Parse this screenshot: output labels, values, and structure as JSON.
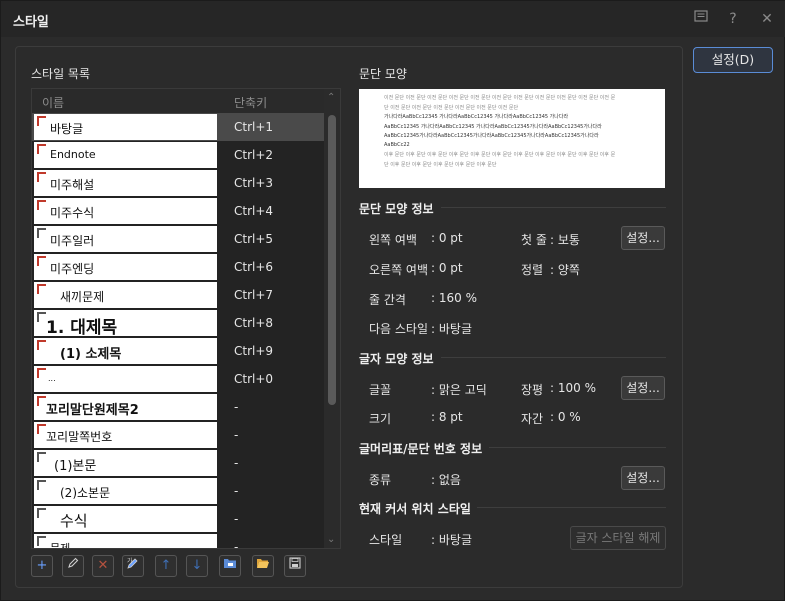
{
  "window": {
    "title": "스타일"
  },
  "titlebar_icons": [
    "memo-icon",
    "help-icon",
    "close-icon"
  ],
  "settings_button": "설정(D)",
  "style_list": {
    "label": "스타일 목록",
    "col_name": "이름",
    "col_key": "단축키",
    "items": [
      {
        "name": "바탕글",
        "key": "Ctrl+1",
        "kind": "char",
        "selected": true
      },
      {
        "name": "Endnote",
        "key": "Ctrl+2",
        "kind": "char"
      },
      {
        "name": "미주해설",
        "key": "Ctrl+3",
        "kind": "char"
      },
      {
        "name": "미주수식",
        "key": "Ctrl+4",
        "kind": "char"
      },
      {
        "name": "미주일러",
        "key": "Ctrl+5",
        "kind": "para"
      },
      {
        "name": "미주엔딩",
        "key": "Ctrl+6",
        "kind": "char"
      },
      {
        "name": "새끼문제",
        "key": "Ctrl+7",
        "kind": "char"
      },
      {
        "name": "1. 대제목",
        "key": "Ctrl+8",
        "kind": "para"
      },
      {
        "name": "(1) 소제목",
        "key": "Ctrl+9",
        "kind": "char"
      },
      {
        "name": "...",
        "key": "Ctrl+0",
        "kind": "char"
      },
      {
        "name": "꼬리말단원제목2",
        "key": "-",
        "kind": "char"
      },
      {
        "name": "꼬리말쪽번호",
        "key": "-",
        "kind": "char"
      },
      {
        "name": "(1)본문",
        "key": "-",
        "kind": "para"
      },
      {
        "name": "(2)소본문",
        "key": "-",
        "kind": "para"
      },
      {
        "name": "수식",
        "key": "-",
        "kind": "para"
      },
      {
        "name": "문제",
        "key": "-",
        "kind": "para"
      }
    ]
  },
  "toolbar_icons": [
    "add-icon",
    "edit-icon",
    "delete-icon",
    "edit-style-icon",
    "move-up-icon",
    "move-down-icon",
    "import-icon",
    "open-icon",
    "save-icon"
  ],
  "paragraph": {
    "label": "문단 모양",
    "preview_lines": [
      "이전 문단 이전 문단 이전 문단 이전 문단 이전 문단 이전 문단 이전 문단 이전 문단 이전 문단 이전 문단 이전 문",
      "단 이전 문단 이전 문단 이전 문단 이전 문단 이전 문단 이전 문단",
      "가나다라AaBbCc12345       가나다라AaBbCc12345       가나다라AaBbCc12345       가나다라",
      "AaBbCc12345  가나다라AaBbCc12345  가나다라AaBbCc12345가나다라AaBbCc12345가나다라",
      "AaBbCc12345가나다라AaBbCc12345가나다라AaBbCc12345가나다라AaBbCc12345가나다라",
      "AaBbCc22",
      "이후 문단 이후 문단 이후 문단 이후 문단 이후 문단 이후 문단 이후 문단 이후 문단 이후 문단 이후 문단 이후 문",
      "단 이후 문단 이후 문단 이후 문단 이후 문단 이후 문단"
    ],
    "info_header": "문단 모양 정보",
    "left_margin_label": "왼쪽 여백",
    "left_margin_value": ": 0 pt",
    "first_line_label": "첫 줄",
    "first_line_value": ": 보통",
    "right_margin_label": "오른쪽 여백",
    "right_margin_value": ": 0 pt",
    "align_label": "정렬",
    "align_value": ": 양쪽",
    "line_spacing_label": "줄 간격",
    "line_spacing_value": ": 160 %",
    "next_style_label": "다음 스타일",
    "next_style_value": ": 바탕글",
    "settings_btn": "설정..."
  },
  "char": {
    "header": "글자 모양 정보",
    "font_label": "글꼴",
    "font_value": ": 맑은 고딕",
    "width_label": "장평",
    "width_value": ": 100 %",
    "size_label": "크기",
    "size_value": ": 8 pt",
    "spacing_label": "자간",
    "spacing_value": ": 0 %",
    "settings_btn": "설정..."
  },
  "bullet": {
    "header": "글머리표/문단 번호 정보",
    "type_label": "종류",
    "type_value": ": 없음",
    "settings_btn": "설정..."
  },
  "cursor": {
    "header": "현재 커서 위치 스타일",
    "style_label": "스타일",
    "style_value": ": 바탕글",
    "release_btn": "글자 스타일 해제"
  }
}
